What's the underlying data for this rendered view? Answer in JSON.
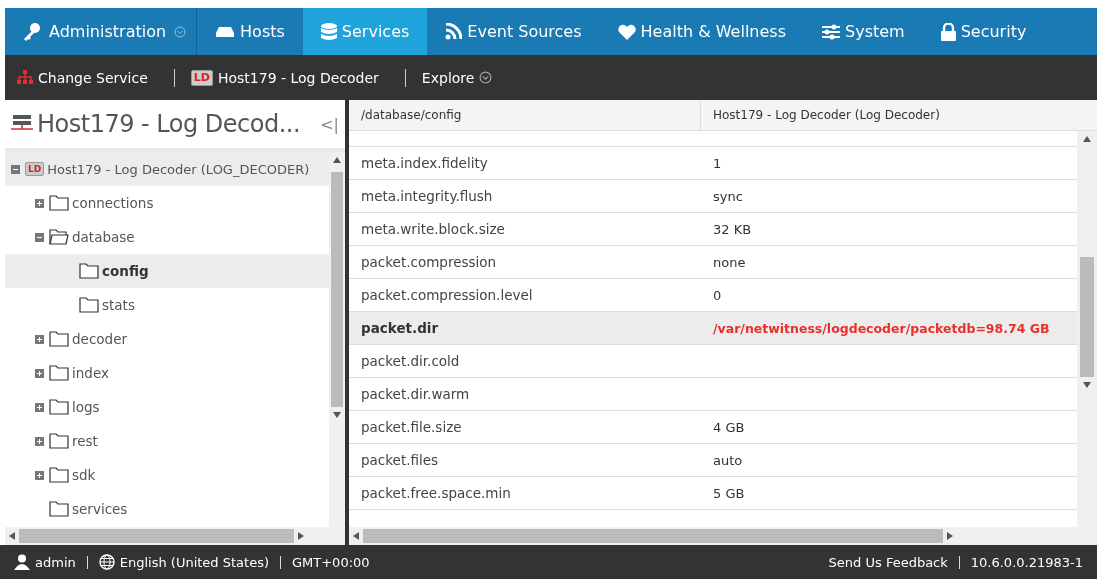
{
  "top_nav": [
    {
      "label": "Administration",
      "kind": "menu",
      "selected": false
    },
    {
      "label": "Hosts",
      "kind": "hosts",
      "selected": false
    },
    {
      "label": "Services",
      "kind": "services",
      "selected": true
    },
    {
      "label": "Event Sources",
      "kind": "feed",
      "selected": false
    },
    {
      "label": "Health & Wellness",
      "kind": "heart",
      "selected": false
    },
    {
      "label": "System",
      "kind": "sliders",
      "selected": false
    },
    {
      "label": "Security",
      "kind": "lock",
      "selected": false
    }
  ],
  "sub_nav": {
    "change_service": "Change Service",
    "service": "Host179 - Log Decoder",
    "service_badge": "LD",
    "explore": "Explore"
  },
  "tree_panel": {
    "title": "Host179 - Log Decod...",
    "collapse": "<|",
    "root": {
      "label": "Host179 - Log Decoder (LOG_DECODER)",
      "badge": "LD",
      "expanded": true,
      "selected": false,
      "children": [
        {
          "label": "connections",
          "kind": "branch",
          "expanded": false,
          "selected": false
        },
        {
          "label": "database",
          "kind": "branch",
          "expanded": true,
          "selected": false,
          "children": [
            {
              "label": "config",
              "kind": "leaf",
              "expanded": false,
              "selected": true
            },
            {
              "label": "stats",
              "kind": "leaf",
              "expanded": false,
              "selected": false
            }
          ]
        },
        {
          "label": "decoder",
          "kind": "branch",
          "expanded": false,
          "selected": false
        },
        {
          "label": "index",
          "kind": "branch",
          "expanded": false,
          "selected": false
        },
        {
          "label": "logs",
          "kind": "branch",
          "expanded": false,
          "selected": false
        },
        {
          "label": "rest",
          "kind": "branch",
          "expanded": false,
          "selected": false
        },
        {
          "label": "sdk",
          "kind": "branch",
          "expanded": false,
          "selected": false
        },
        {
          "label": "services",
          "kind": "leaf",
          "expanded": false,
          "selected": false
        }
      ]
    }
  },
  "table": {
    "columns": [
      "/database/config",
      "Host179 - Log Decoder (Log Decoder)"
    ],
    "rows": [
      {
        "name": "meta.index.fidelity",
        "value": "1",
        "selected": false
      },
      {
        "name": "meta.integrity.flush",
        "value": "sync",
        "selected": false
      },
      {
        "name": "meta.write.block.size",
        "value": "32 KB",
        "selected": false
      },
      {
        "name": "packet.compression",
        "value": "none",
        "selected": false
      },
      {
        "name": "packet.compression.level",
        "value": "0",
        "selected": false
      },
      {
        "name": "packet.dir",
        "value": "/var/netwitness/logdecoder/packetdb=98.74 GB",
        "selected": true
      },
      {
        "name": "packet.dir.cold",
        "value": "",
        "selected": false
      },
      {
        "name": "packet.dir.warm",
        "value": "",
        "selected": false
      },
      {
        "name": "packet.file.size",
        "value": "4 GB",
        "selected": false
      },
      {
        "name": "packet.files",
        "value": "auto",
        "selected": false
      },
      {
        "name": "packet.free.space.min",
        "value": "5 GB",
        "selected": false
      }
    ]
  },
  "status_bar": {
    "user": "admin",
    "language": "English (United States)",
    "timezone": "GMT+00:00",
    "feedback": "Send Us Feedback",
    "version": "10.6.0.0.21983-1"
  }
}
